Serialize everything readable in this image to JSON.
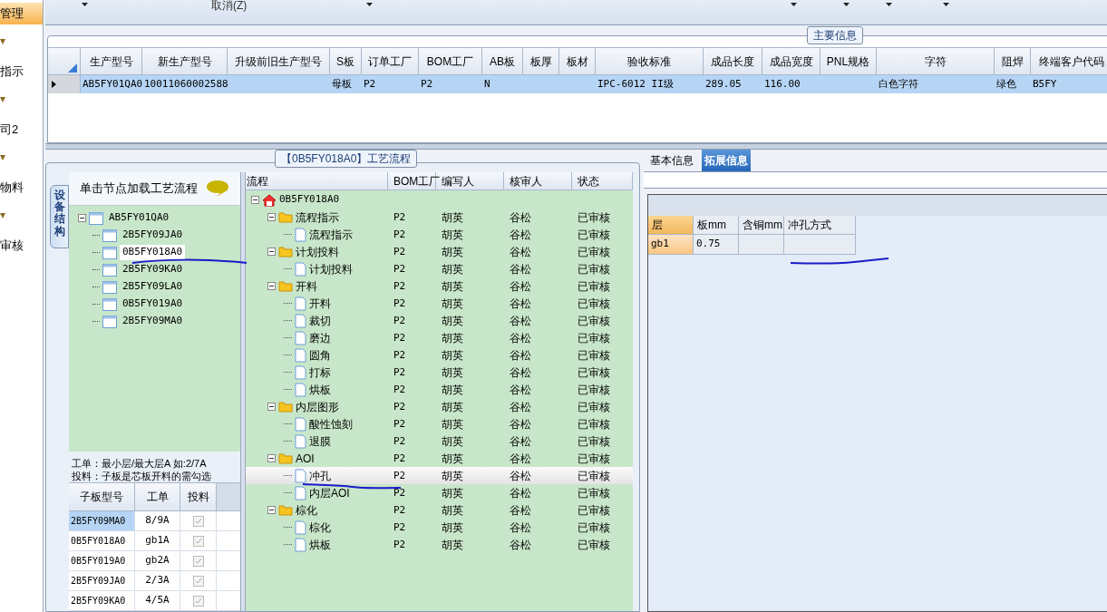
{
  "sidebar": {
    "items": [
      {
        "label": "管理",
        "selected": true
      },
      {
        "label": "指示",
        "selected": false
      },
      {
        "label": "司2",
        "selected": false
      },
      {
        "label": "物料",
        "selected": false
      },
      {
        "label": "审核",
        "selected": false
      }
    ]
  },
  "toolbar": {
    "label": "取消(Z)"
  },
  "main_info": {
    "title": "主要信息",
    "columns": [
      "生产型号",
      "新生产型号",
      "升级前旧生产型号",
      "S板",
      "订单工厂",
      "BOM工厂",
      "AB板",
      "板厚",
      "板材",
      "验收标准",
      "成品长度",
      "成品宽度",
      "PNL规格",
      "字符",
      "阻焊",
      "终端客户代码"
    ],
    "rows": [
      {
        "selected": true,
        "cells": [
          "AB5FY01QA0",
          "10011060002588",
          "",
          "母板",
          "P2",
          "P2",
          "N",
          "",
          "",
          "IPC-6012 II级",
          "289.05",
          "116.00",
          "",
          "白色字符",
          "绿色",
          "B5FY"
        ]
      }
    ]
  },
  "process_panel": {
    "title": "【0B5FY018A0】工艺流程",
    "side_tab": "设备结构",
    "structure": {
      "hint": "单击节点加载工艺流程",
      "tree": {
        "label": "AB5FY01QA0",
        "expanded": true,
        "selected": false,
        "children": [
          {
            "label": "2B5FY09JA0",
            "selected": false
          },
          {
            "label": "0B5FY018A0",
            "selected": true
          },
          {
            "label": "2B5FY09KA0",
            "selected": false
          },
          {
            "label": "2B5FY09LA0",
            "selected": false
          },
          {
            "label": "0B5FY019A0",
            "selected": false
          },
          {
            "label": "2B5FY09MA0",
            "selected": false
          }
        ]
      }
    },
    "notes": [
      "工单：最小层/最大层A 如:2/7A",
      "投料：子板是芯板开料的需勾选"
    ],
    "sub_boards": {
      "columns": [
        "子板型号",
        "工单",
        "投料"
      ],
      "rows": [
        {
          "model": "2B5FY09MA0",
          "order": "8/9A",
          "checked": true,
          "selected": true
        },
        {
          "model": "0B5FY018A0",
          "order": "gb1A",
          "checked": true,
          "selected": false
        },
        {
          "model": "0B5FY019A0",
          "order": "gb2A",
          "checked": true,
          "selected": false
        },
        {
          "model": "2B5FY09JA0",
          "order": "2/3A",
          "checked": true,
          "selected": false
        },
        {
          "model": "2B5FY09KA0",
          "order": "4/5A",
          "checked": true,
          "selected": false
        }
      ]
    },
    "flow": {
      "columns": [
        "流程",
        "BOM工厂",
        "编写人",
        "核审人",
        "状态"
      ],
      "root": {
        "name": "0B5FY018A0",
        "selected": false,
        "children": [
          {
            "name": "流程指示",
            "bom": "P2",
            "writer": "胡英",
            "reviewer": "谷松",
            "status": "已审核",
            "selected": false,
            "children": [
              {
                "name": "流程指示",
                "bom": "P2",
                "writer": "胡英",
                "reviewer": "谷松",
                "status": "已审核",
                "selected": false
              }
            ]
          },
          {
            "name": "计划投料",
            "bom": "P2",
            "writer": "胡英",
            "reviewer": "谷松",
            "status": "已审核",
            "selected": false,
            "children": [
              {
                "name": "计划投料",
                "bom": "P2",
                "writer": "胡英",
                "reviewer": "谷松",
                "status": "已审核",
                "selected": false
              }
            ]
          },
          {
            "name": "开料",
            "bom": "P2",
            "writer": "胡英",
            "reviewer": "谷松",
            "status": "已审核",
            "selected": false,
            "children": [
              {
                "name": "开料",
                "bom": "P2",
                "writer": "胡英",
                "reviewer": "谷松",
                "status": "已审核",
                "selected": false
              },
              {
                "name": "裁切",
                "bom": "P2",
                "writer": "胡英",
                "reviewer": "谷松",
                "status": "已审核",
                "selected": false
              },
              {
                "name": "磨边",
                "bom": "P2",
                "writer": "胡英",
                "reviewer": "谷松",
                "status": "已审核",
                "selected": false
              },
              {
                "name": "圆角",
                "bom": "P2",
                "writer": "胡英",
                "reviewer": "谷松",
                "status": "已审核",
                "selected": false
              },
              {
                "name": "打标",
                "bom": "P2",
                "writer": "胡英",
                "reviewer": "谷松",
                "status": "已审核",
                "selected": false
              },
              {
                "name": "烘板",
                "bom": "P2",
                "writer": "胡英",
                "reviewer": "谷松",
                "status": "已审核",
                "selected": false
              }
            ]
          },
          {
            "name": "内层图形",
            "bom": "P2",
            "writer": "胡英",
            "reviewer": "谷松",
            "status": "已审核",
            "selected": false,
            "children": [
              {
                "name": "酸性蚀刻",
                "bom": "P2",
                "writer": "胡英",
                "reviewer": "谷松",
                "status": "已审核",
                "selected": false
              },
              {
                "name": "退膜",
                "bom": "P2",
                "writer": "胡英",
                "reviewer": "谷松",
                "status": "已审核",
                "selected": false
              }
            ]
          },
          {
            "name": "AOI",
            "bom": "P2",
            "writer": "胡英",
            "reviewer": "谷松",
            "status": "已审核",
            "selected": false,
            "children": [
              {
                "name": "冲孔",
                "bom": "P2",
                "writer": "胡英",
                "reviewer": "谷松",
                "status": "已审核",
                "selected": true
              },
              {
                "name": "内层AOI",
                "bom": "P2",
                "writer": "胡英",
                "reviewer": "谷松",
                "status": "已审核",
                "selected": false
              }
            ]
          },
          {
            "name": "棕化",
            "bom": "P2",
            "writer": "胡英",
            "reviewer": "谷松",
            "status": "已审核",
            "selected": false,
            "children": [
              {
                "name": "棕化",
                "bom": "P2",
                "writer": "胡英",
                "reviewer": "谷松",
                "status": "已审核",
                "selected": false
              },
              {
                "name": "烘板",
                "bom": "P2",
                "writer": "胡英",
                "reviewer": "谷松",
                "status": "已审核",
                "selected": false
              }
            ]
          }
        ]
      }
    }
  },
  "detail_panel": {
    "tabs": [
      {
        "label": "基本信息",
        "selected": false
      },
      {
        "label": "拓展信息",
        "selected": true
      }
    ],
    "layers": {
      "columns": [
        "层",
        "板mm",
        "含铜mm",
        "冲孔方式"
      ],
      "rows": [
        {
          "cells": [
            "gb1",
            "0.75",
            "",
            ""
          ]
        }
      ]
    }
  }
}
